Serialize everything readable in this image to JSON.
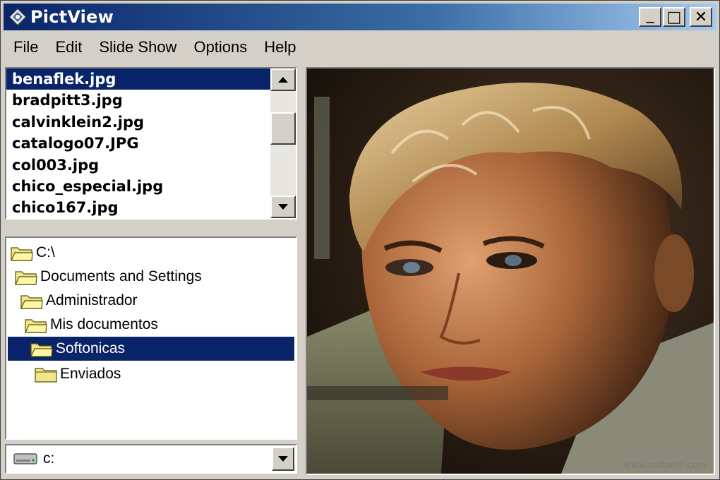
{
  "window": {
    "title": "PictView",
    "minimize": "_",
    "maximize": "□",
    "close": "✕"
  },
  "menu": {
    "items": [
      "File",
      "Edit",
      "Slide Show",
      "Options",
      "Help"
    ]
  },
  "file_list": {
    "items": [
      "benaflek.jpg",
      "bradpitt3.jpg",
      "calvinklein2.jpg",
      "catalogo07.JPG",
      "col003.jpg",
      "chico_especial.jpg",
      "chico167.jpg"
    ],
    "selected": "benaflek.jpg"
  },
  "folder_tree": {
    "nodes": [
      "C:\\",
      "Documents and Settings",
      "Administrador",
      "Mis documentos",
      "Softonicas",
      "Enviados"
    ],
    "selected": "Softonicas"
  },
  "drive": {
    "value": "c:"
  },
  "preview": {
    "watermark": "www.softonic.com"
  },
  "icons": {
    "app": "pictview-app-icon",
    "folder": "folder-icon",
    "drive": "drive-icon",
    "scroll_up": "scroll-up-arrow-icon",
    "scroll_down": "scroll-down-arrow-icon",
    "dropdown": "chevron-down-icon"
  },
  "colors": {
    "titlebar": "#0a246a",
    "selection": "#0a246a",
    "face": "#d4d0c8"
  }
}
